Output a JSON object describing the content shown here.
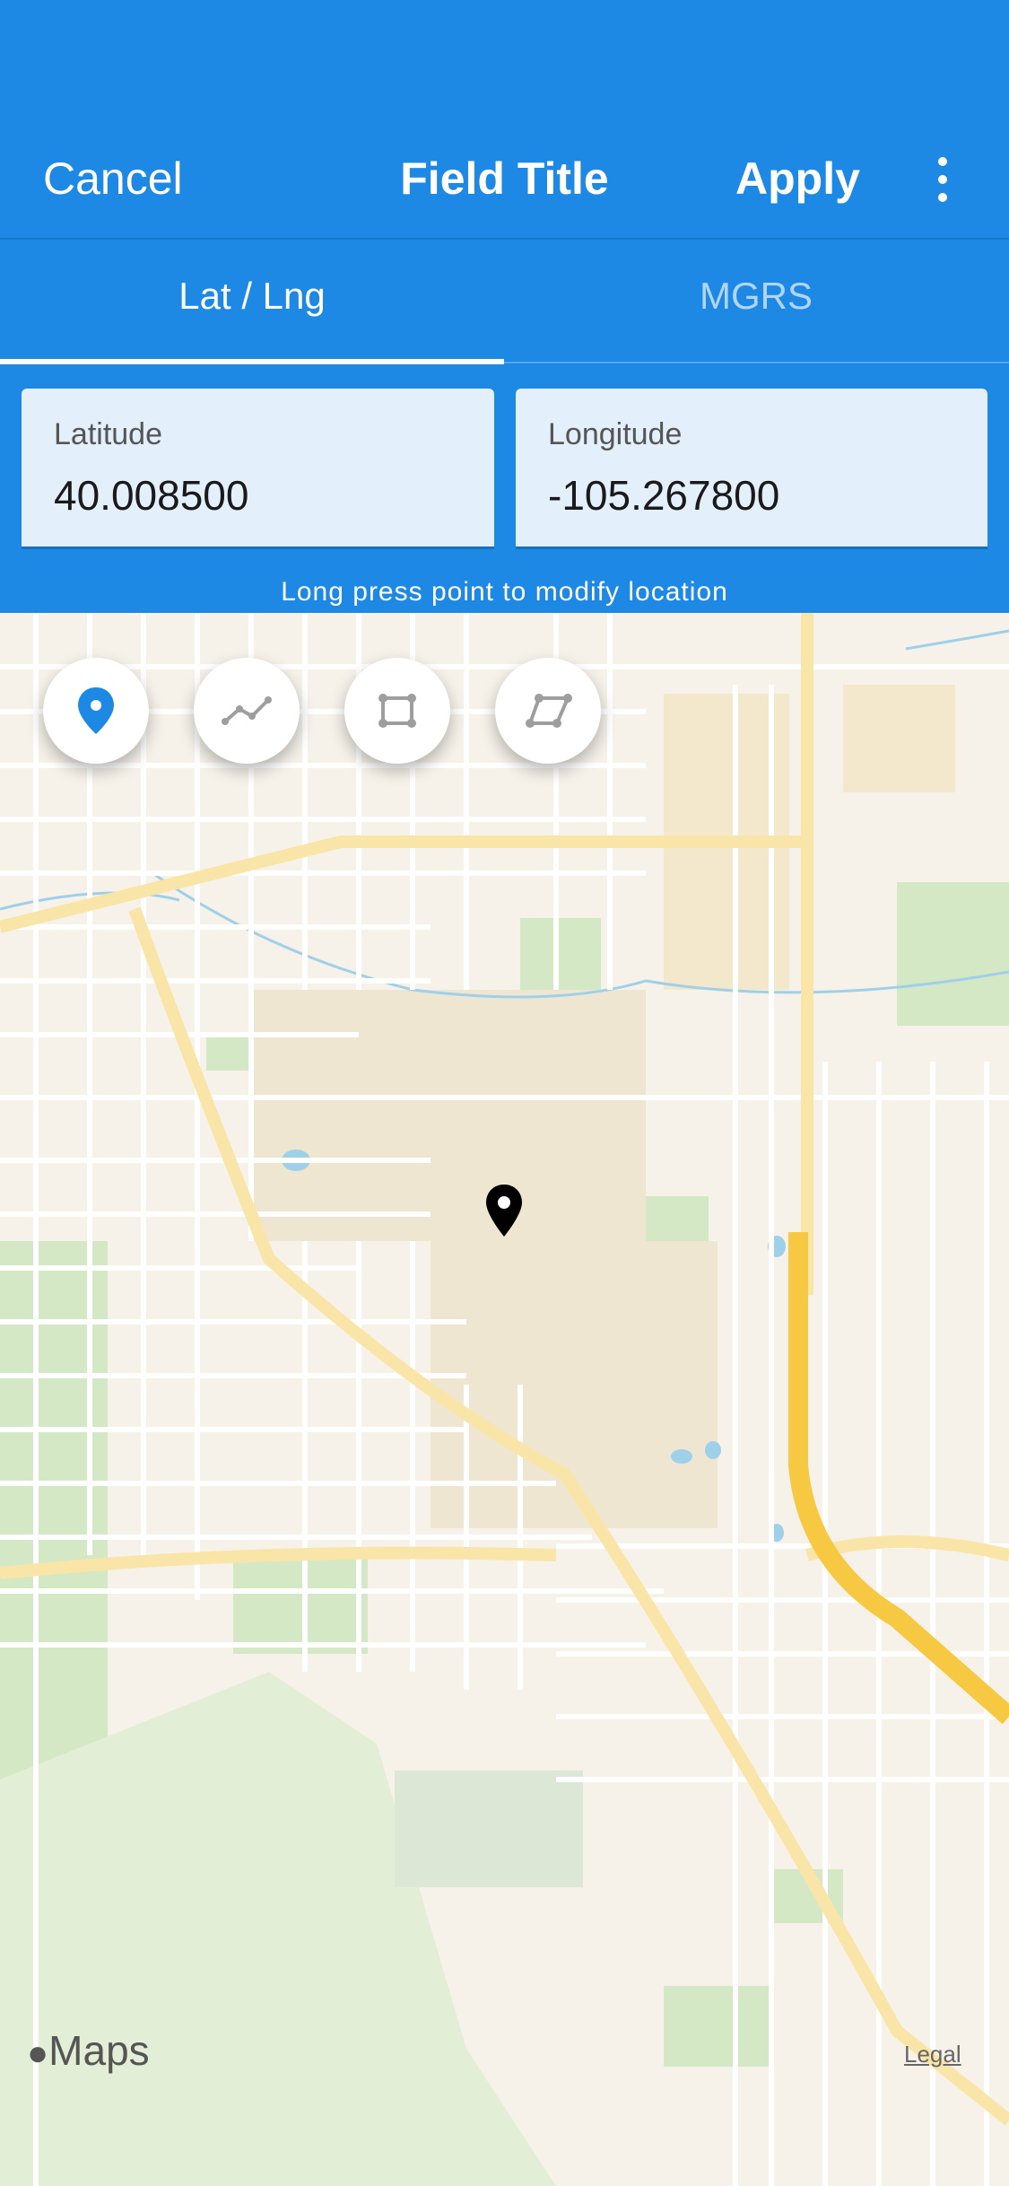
{
  "nav": {
    "cancel_label": "Cancel",
    "title": "Field Title",
    "apply_label": "Apply",
    "more_icon": "more-vertical-icon"
  },
  "tabs": [
    {
      "label": "Lat / Lng",
      "selected": true
    },
    {
      "label": "MGRS",
      "selected": false
    }
  ],
  "coordinates": {
    "latitude_label": "Latitude",
    "latitude_value": "40.008500",
    "longitude_label": "Longitude",
    "longitude_value": "-105.267800"
  },
  "hint_text": "Long press point to modify location",
  "tools": [
    {
      "icon": "pin-icon",
      "active": true
    },
    {
      "icon": "polyline-icon",
      "active": false
    },
    {
      "icon": "rectangle-icon",
      "active": false
    },
    {
      "icon": "polygon-icon",
      "active": false
    }
  ],
  "map": {
    "logo_text": "Maps",
    "legal_label": "Legal"
  },
  "colors": {
    "primary": "#1e88e5",
    "field_bg": "#e3effa",
    "highway": "#f7c842",
    "arterial": "#f9e5a8",
    "park": "#d5e8c5"
  }
}
